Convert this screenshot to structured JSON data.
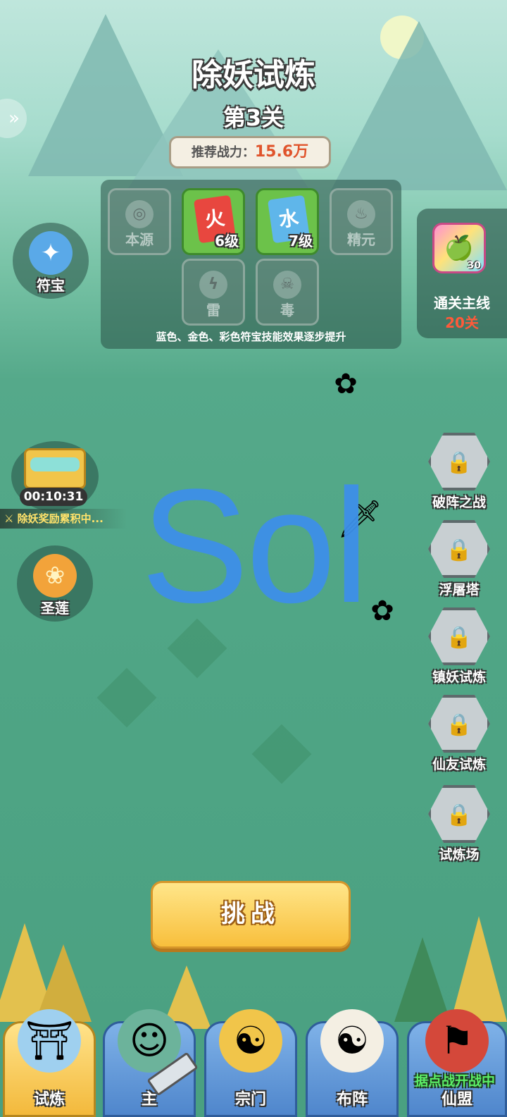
{
  "header": {
    "title": "除妖试炼",
    "stage": "第3关",
    "power_label": "推荐战力：",
    "power_value": "15.6万"
  },
  "skill_panel": {
    "slots": [
      {
        "label": "本源",
        "icon": "swirl-icon"
      },
      {
        "level": "6级",
        "icon": "red-talisman-icon"
      },
      {
        "level": "7级",
        "icon": "blue-talisman-icon"
      },
      {
        "label": "精元",
        "icon": "flame-icon"
      },
      {
        "label": "雷",
        "icon": "thunder-icon"
      },
      {
        "label": "毒",
        "icon": "poison-skull-icon"
      }
    ],
    "tip": "蓝色、金色、彩色符宝技能效果逐步提升"
  },
  "reward": {
    "count": "30",
    "label": "通关主线",
    "value": "20关"
  },
  "left": {
    "fubao": "符宝",
    "timer": "00:10:31",
    "accumulating": "除妖奖励累积中...",
    "lotus": "圣莲"
  },
  "modes": [
    "破阵之战",
    "浮屠塔",
    "镇妖试炼",
    "仙友试炼",
    "试炼场"
  ],
  "watermark": "Sol",
  "challenge_label": "挑战",
  "nav": {
    "items": [
      "试炼",
      "主",
      "宗门",
      "布阵",
      "仙盟"
    ],
    "badge": "据点战开战中"
  },
  "colors": {
    "accent_gold": "#f8bf3c",
    "nav_blue": "#4f86cc",
    "power_red": "#e0542c",
    "reward_red": "#ff5a3a",
    "badge_green": "#5cf067"
  }
}
